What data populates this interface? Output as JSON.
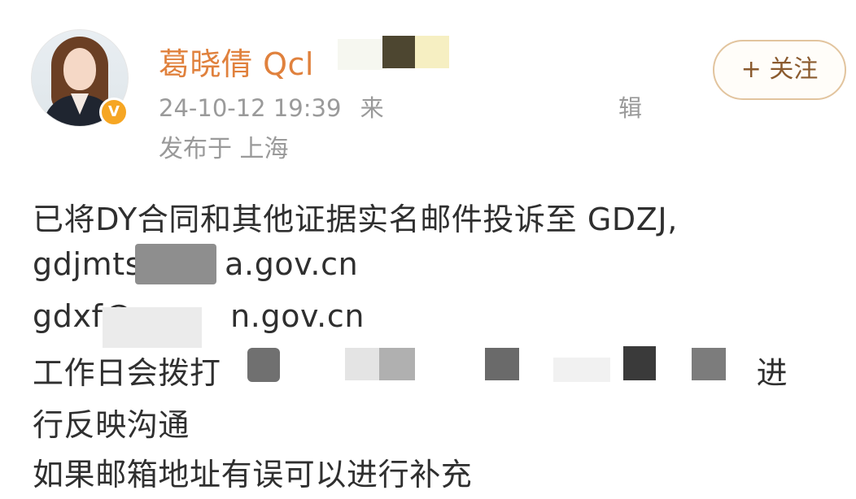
{
  "post": {
    "author": {
      "name": "葛晓倩 Qcl",
      "avatar_icon": "avatar-photo-icon",
      "verified_badge": "V"
    },
    "meta": {
      "timestamp": "24-10-12 19:39",
      "source_prefix": "来",
      "source_suffix": "辑",
      "location": "发布于 上海"
    },
    "follow_label": "+ 关注",
    "content": {
      "line1": "已将DY合同和其他证据实名邮件投诉至 GDZJ,",
      "line2_prefix": "gdjmts",
      "line2_suffix": "a.gov.cn",
      "line3_prefix": "gdxf@",
      "line3_suffix": "n.gov.cn",
      "line4_prefix": "工作日会拨打",
      "line4_suffix": "进",
      "line5": "行反映沟通",
      "line6": "如果邮箱地址有误可以进行补充"
    },
    "colors": {
      "username": "#e0813d",
      "meta": "#9a9a9a",
      "button_border": "#e2c49e",
      "badge": "#f6a623"
    }
  }
}
